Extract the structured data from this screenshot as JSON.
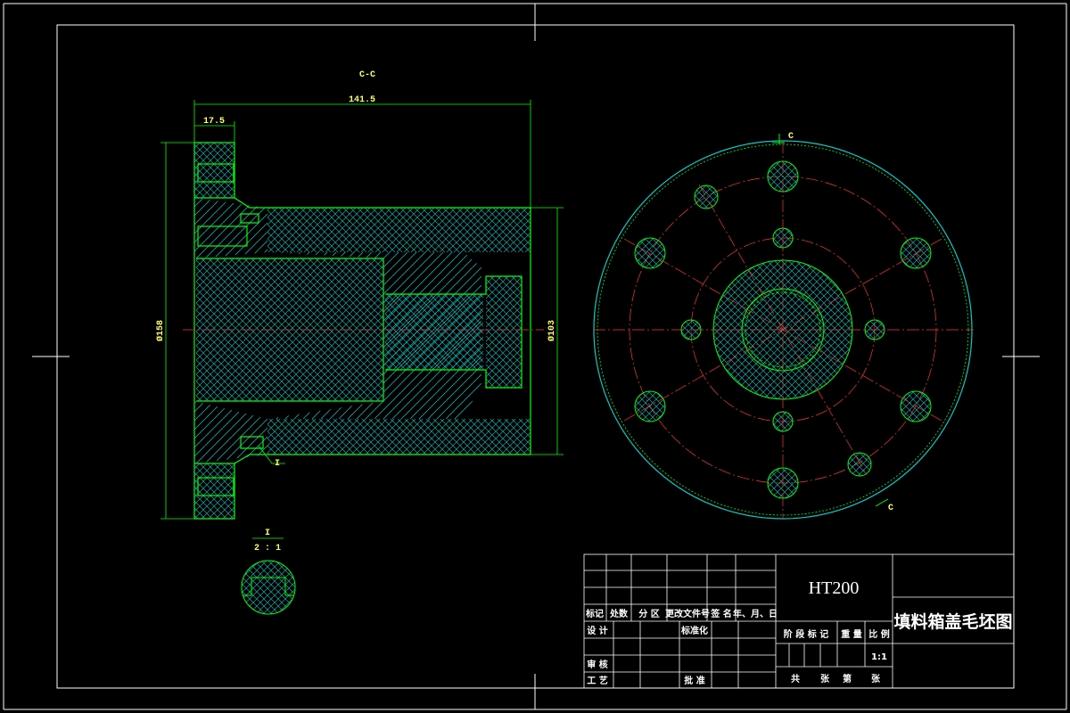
{
  "views": {
    "section_label": "C-C",
    "dim_total_length": "141.5",
    "dim_flange_thickness": "17.5",
    "dim_flange_diameter": "Ø158",
    "dim_body_diameter": "Ø103",
    "detail_marker": "I",
    "detail_label": "I",
    "detail_scale": "2 : 1",
    "cut_label_top": "C",
    "cut_label_bottom": "C"
  },
  "title_block": {
    "material": "HT200",
    "drawing_name": "填料箱盖毛坯图",
    "header_labels": [
      "标记",
      "处数",
      "分 区",
      "更改文件号",
      "签 名",
      "年、月、日"
    ],
    "row_design": "设 计",
    "row_standard": "标准化",
    "row_review": "审 核",
    "row_process": "工 艺",
    "row_approve": "批 准",
    "stage_mark": "阶 段 标 记",
    "weight": "重 量",
    "scale_label": "比 例",
    "scale_value": "1:1",
    "sheets_total": "共",
    "sheets_word": "张",
    "sheet_no": "第",
    "sheet_word": "张"
  },
  "colors": {
    "background": "#000000",
    "frame": "#ffffff",
    "outline": "#00ff00",
    "hatch": "#00cccc",
    "center_line": "#ff3333",
    "text": "#ffffff",
    "dimension_text": "#ffff66"
  }
}
